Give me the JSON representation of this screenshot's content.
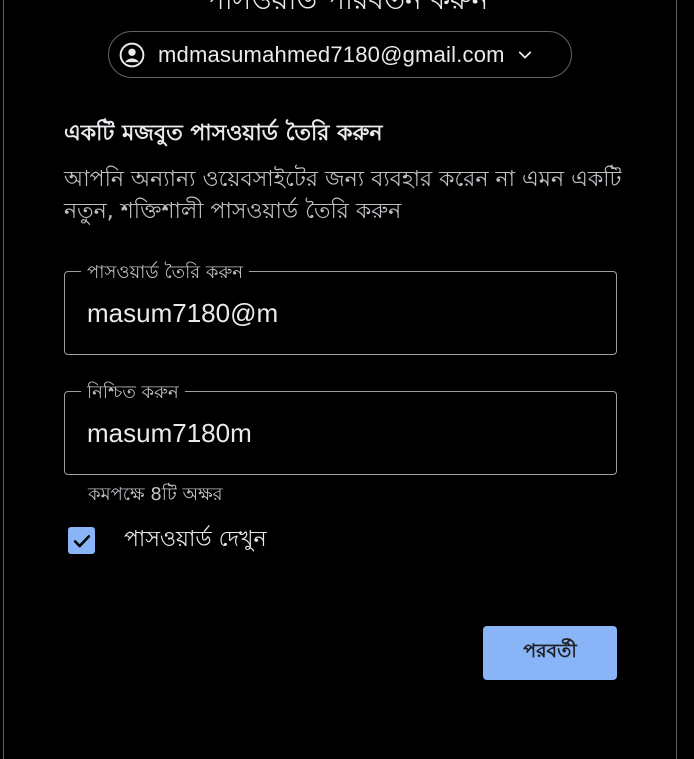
{
  "header": {
    "page_heading": "পাসওয়ার্ড পরিবর্তন করুন"
  },
  "account": {
    "email": "mdmasumahmed7180@gmail.com",
    "avatar_icon": "account-circle-icon",
    "chevron_icon": "chevron-down-icon"
  },
  "section": {
    "title": "একটি মজবুত পাসওয়ার্ড তৈরি করুন",
    "description": "আপনি অন্যান্য ওয়েবসাইটের জন্য ব্যবহার করেন না এমন একটি নতুন, শক্তিশালী পাসওয়ার্ড তৈরি করুন"
  },
  "fields": {
    "create": {
      "label": "পাসওয়ার্ড তৈরি করুন",
      "value": "masum7180@m"
    },
    "confirm": {
      "label": "নিশ্চিত করুন",
      "value": "masum7180m"
    },
    "helper": "কমপক্ষে 8টি অক্ষর"
  },
  "show_password": {
    "label": "পাসওয়ার্ড দেখুন",
    "checked": true,
    "check_icon": "check-icon"
  },
  "actions": {
    "next_label": "পরবর্তী"
  },
  "colors": {
    "background": "#000000",
    "accent": "#8ab4f8",
    "text": "#e8eaed",
    "secondary_text": "#bdc1c6",
    "border": "#9aa0a6"
  }
}
